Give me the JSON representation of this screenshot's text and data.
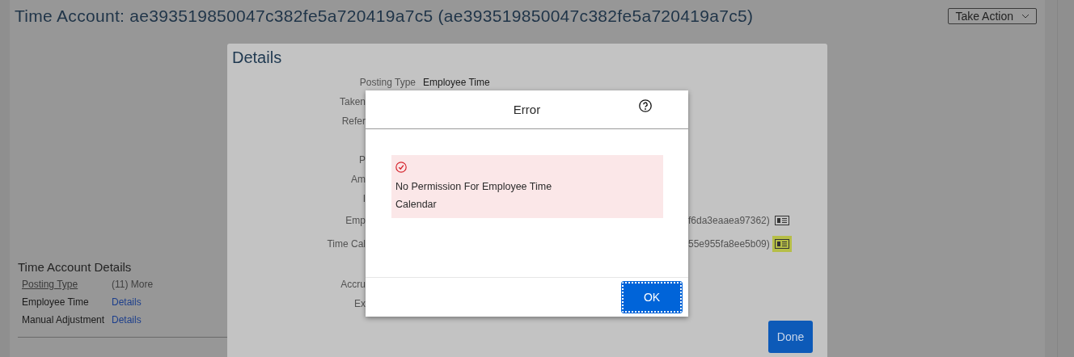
{
  "page": {
    "title": "Time Account: ae393519850047c382fe5a720419a7c5 (ae393519850047c382fe5a720419a7c5)",
    "action_button": "Take Action",
    "section": {
      "title": "Time Account Details",
      "column_header": "Posting Type",
      "more": "(11) More",
      "rows": [
        {
          "type": "Employee Time",
          "link": "Details"
        },
        {
          "type": "Manual Adjustment",
          "link": "Details"
        }
      ]
    }
  },
  "details_dialog": {
    "title": "Details",
    "first_row": {
      "label": "Posting Type",
      "value": "Employee Time"
    },
    "rows": [
      {
        "label": "Taken",
        "gap_before": false
      },
      {
        "label": "Refer",
        "gap_before": false
      },
      {
        "label": "P",
        "gap_before": true
      },
      {
        "label": "Am",
        "gap_before": false
      },
      {
        "label": "I",
        "gap_before": false
      },
      {
        "label": "Emp",
        "gap_before": false,
        "value_end": "f6da3eaaea97362)",
        "icon_highlighted": false
      },
      {
        "label": "Time Cal",
        "gap_before": false,
        "value_end": "55e955fa8ee5b09)",
        "icon_highlighted": true
      },
      {
        "label": "Accru",
        "gap_before": true
      },
      {
        "label": "Ex",
        "gap_before": false
      }
    ],
    "done_button": "Done"
  },
  "error_dialog": {
    "title": "Error",
    "message": "No Permission For Employee Time Calendar",
    "ok_button": "OK"
  }
}
